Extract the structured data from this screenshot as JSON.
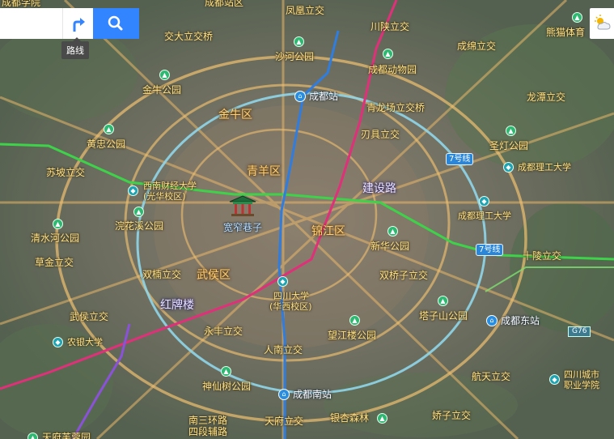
{
  "toolbar": {
    "search_placeholder": "",
    "route_tooltip": "路线"
  },
  "map": {
    "districts": [
      "金牛区",
      "青羊区",
      "锦江区",
      "武侯区"
    ],
    "roads": [
      "建设路",
      "红牌楼"
    ],
    "places": {
      "chengdu_xueyuan": "成都学院",
      "chengdu_zhanqu": "成都站区",
      "fenghuang": "凤凰立交",
      "chuanshan": "川陕立交",
      "jiaoda": "交大立交桥",
      "shahe_park": "沙河公园",
      "chengdu_zoo": "成都动物园",
      "chengmian": "成绵立交",
      "panda_base": "熊猫体育",
      "jinniu_park": "金牛公园",
      "chengdu_station": "成都站",
      "qinglongchang": "青龙场立交桥",
      "longtan": "龙潭立交",
      "huangzhong_park": "黄忠公园",
      "renju": "刃具立交",
      "shengdeng_park": "圣灯公园",
      "cut_univ": "成都理工大学",
      "sufu": "苏坡立交",
      "swufe": "西南财经大学",
      "swufe_campus": "(光华校区)",
      "huanhuaxi_park": "浣花溪公园",
      "kuanzhai": "宽窄巷子",
      "cut_univ2": "成都理工大学",
      "qingshuihe_park": "清水河公园",
      "xinhua_park": "新华公园",
      "caojin": "草金立交",
      "shuangnan": "双楠立交",
      "scu": "四川大学",
      "scu_campus": "(华西校区)",
      "shuangqiaozi": "双桥子立交",
      "shiling": "十陵立交",
      "wuhouci": "武侯立交",
      "tazishan_park": "塔子山公园",
      "chengdu_east": "成都东站",
      "nongyin": "农银大学",
      "yongfeng": "永丰立交",
      "wangjianglou_park": "望江楼公园",
      "renmin_south": "人南立交",
      "hangtian": "航天立交",
      "sichuan_cvc": "四川城市",
      "sichuan_cvc2": "职业学院",
      "shenxianshu_park": "神仙树公园",
      "chengdu_south": "成都南站",
      "nansanhuan": "南三环路",
      "sijiang": "四段辅路",
      "tianfu": "天府立交",
      "yinxing": "银杏森林",
      "jiaozi": "娇子立交",
      "tianfu_park": "天府芙蓉园"
    },
    "metro_badges": [
      "7号线",
      "7号线"
    ],
    "highway_shield": "G76"
  },
  "colors": {
    "search_blue": "#3385ff",
    "ring_light_blue": "#8fd6ea",
    "metro_green": "#3ed24a",
    "metro_blue": "#2f7de0",
    "metro_pink": "#e0307a",
    "metro_purple": "#8a52d8"
  }
}
